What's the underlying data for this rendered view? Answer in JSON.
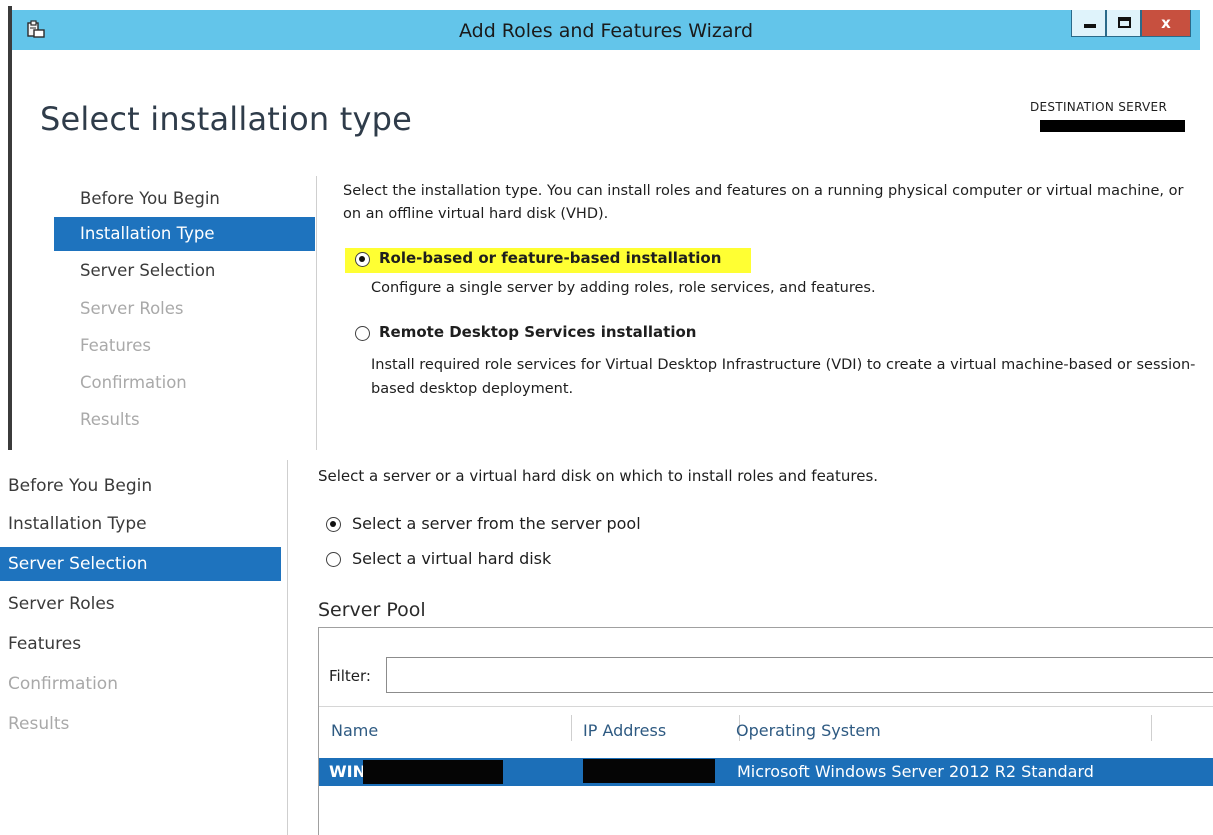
{
  "window": {
    "title": "Add Roles and Features Wizard",
    "close_glyph": "x",
    "accent_color": "#63c5ea",
    "icon": "wizard-app-icon"
  },
  "page": {
    "title": "Select installation type",
    "destination_label": "DESTINATION SERVER"
  },
  "top_nav": {
    "items": [
      {
        "label": "Before You Begin",
        "state": "done"
      },
      {
        "label": "Installation Type",
        "state": "active"
      },
      {
        "label": "Server Selection",
        "state": "done"
      },
      {
        "label": "Server Roles",
        "state": "disabled"
      },
      {
        "label": "Features",
        "state": "disabled"
      },
      {
        "label": "Confirmation",
        "state": "disabled"
      },
      {
        "label": "Results",
        "state": "disabled"
      }
    ]
  },
  "install_type": {
    "description": "Select the installation type. You can install roles and features on a running physical computer or virtual machine, or on an offline virtual hard disk (VHD).",
    "options": [
      {
        "label": "Role-based or feature-based installation",
        "description": "Configure a single server by adding roles, role services, and features.",
        "selected": true,
        "highlight_color": "#ffff33"
      },
      {
        "label": "Remote Desktop Services installation",
        "description": "Install required role services for Virtual Desktop Infrastructure (VDI) to create a virtual machine-based or session-based desktop deployment.",
        "selected": false
      }
    ]
  },
  "bottom_nav": {
    "items": [
      {
        "label": "Before You Begin",
        "state": "done"
      },
      {
        "label": "Installation Type",
        "state": "done"
      },
      {
        "label": "Server Selection",
        "state": "active"
      },
      {
        "label": "Server Roles",
        "state": "done"
      },
      {
        "label": "Features",
        "state": "done"
      },
      {
        "label": "Confirmation",
        "state": "disabled"
      },
      {
        "label": "Results",
        "state": "disabled"
      }
    ]
  },
  "server_selection": {
    "description": "Select a server or a virtual hard disk on which to install roles and features.",
    "options": [
      {
        "label": "Select a server from the server pool",
        "selected": true
      },
      {
        "label": "Select a virtual hard disk",
        "selected": false
      }
    ],
    "pool_title": "Server Pool",
    "filter_label": "Filter:",
    "filter_value": "",
    "columns": [
      "Name",
      "IP Address",
      "Operating System"
    ],
    "rows": [
      {
        "name": "WIN",
        "ip": "",
        "os": "Microsoft Windows Server 2012 R2 Standard",
        "selected": true
      }
    ]
  }
}
